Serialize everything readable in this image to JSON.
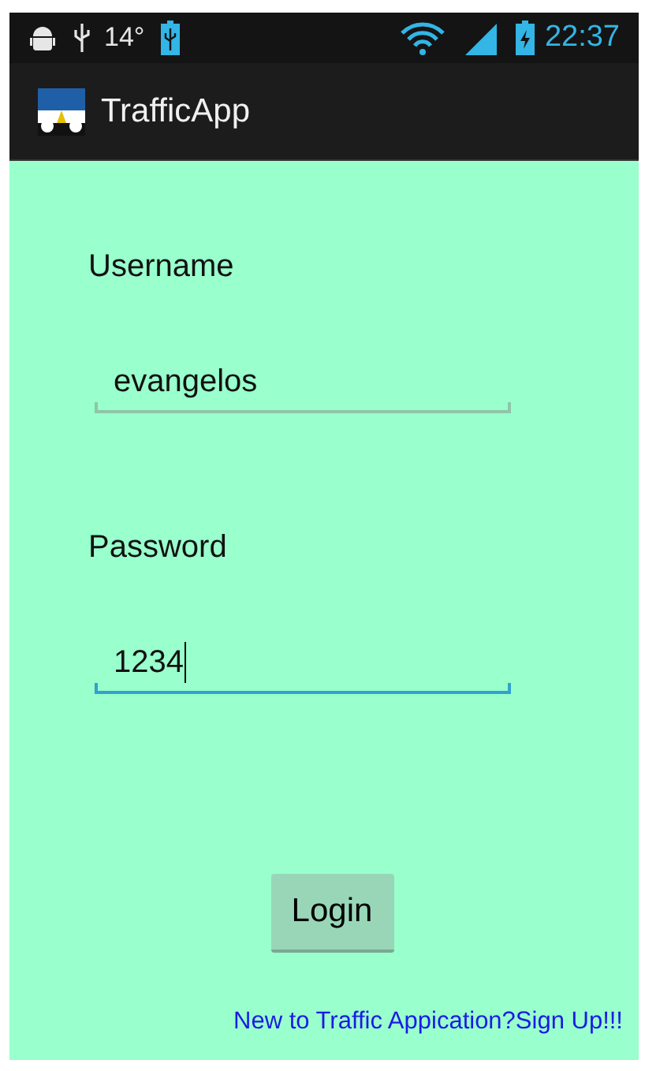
{
  "status_bar": {
    "temperature": "14°",
    "time": "22:37"
  },
  "action_bar": {
    "title": "TrafficApp"
  },
  "fields": [
    {
      "label": "Username",
      "value": "evangelos",
      "focused": false
    },
    {
      "label": "Password",
      "value": "1234",
      "focused": true
    }
  ],
  "login_button": {
    "label": "Login"
  },
  "signup_link": {
    "label": "New to Traffic Appication?Sign Up!!!"
  }
}
